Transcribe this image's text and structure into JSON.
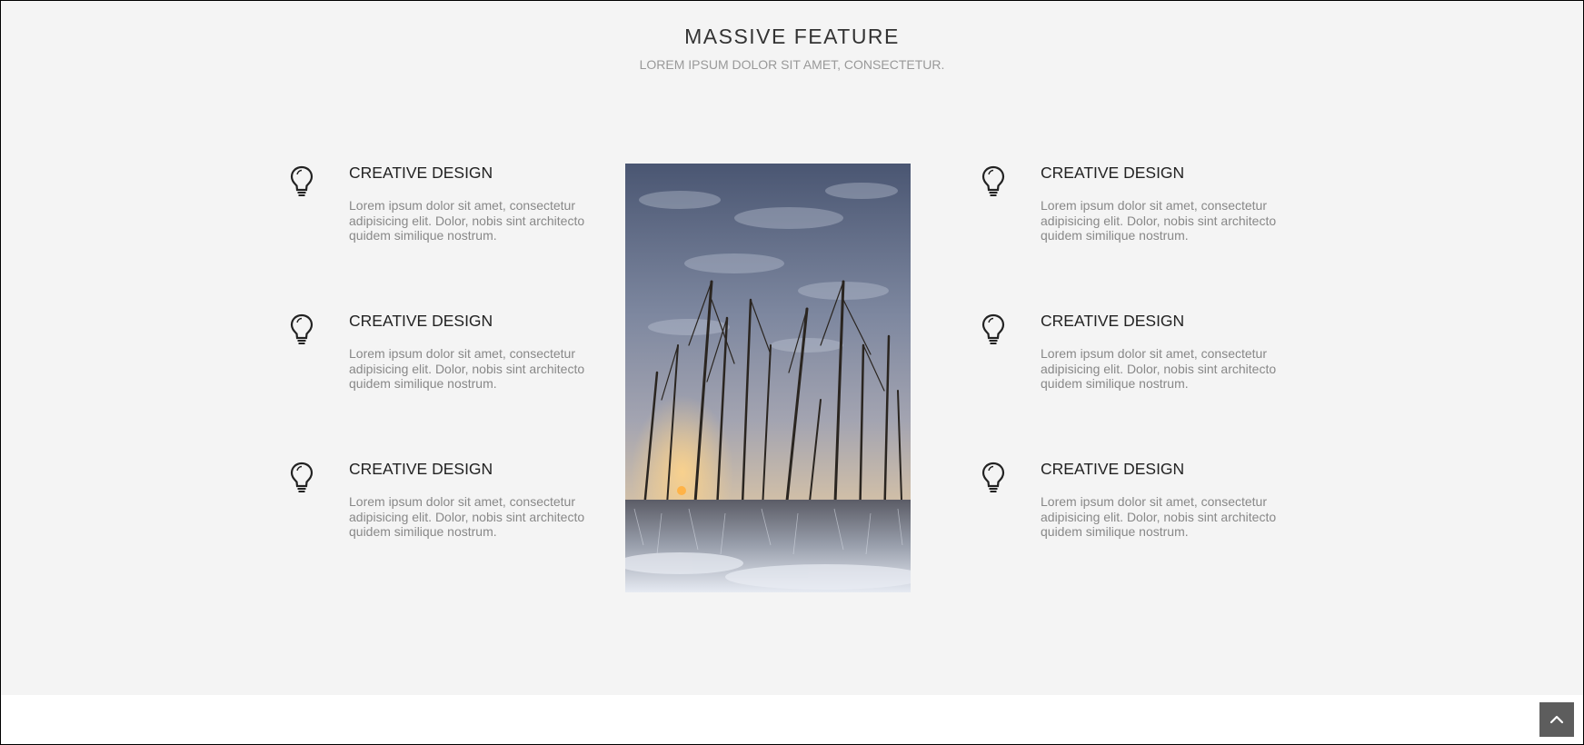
{
  "section": {
    "title": "MASSIVE FEATURE",
    "subtitle": "LOREM IPSUM DOLOR SIT AMET, CONSECTETUR."
  },
  "features": [
    {
      "icon": "lightbulb-icon",
      "title": "CREATIVE DESIGN",
      "text": "Lorem ipsum dolor sit amet, consectetur adipisicing elit. Dolor, nobis sint architecto quidem similique nostrum."
    },
    {
      "icon": "lightbulb-icon",
      "title": "CREATIVE DESIGN",
      "text": "Lorem ipsum dolor sit amet, consectetur adipisicing elit. Dolor, nobis sint architecto quidem similique nostrum."
    },
    {
      "icon": "lightbulb-icon",
      "title": "CREATIVE DESIGN",
      "text": "Lorem ipsum dolor sit amet, consectetur adipisicing elit. Dolor, nobis sint architecto quidem similique nostrum."
    },
    {
      "icon": "lightbulb-icon",
      "title": "CREATIVE DESIGN",
      "text": "Lorem ipsum dolor sit amet, consectetur adipisicing elit. Dolor, nobis sint architecto quidem similique nostrum."
    },
    {
      "icon": "lightbulb-icon",
      "title": "CREATIVE DESIGN",
      "text": "Lorem ipsum dolor sit amet, consectetur adipisicing elit. Dolor, nobis sint architecto quidem similique nostrum."
    },
    {
      "icon": "lightbulb-icon",
      "title": "CREATIVE DESIGN",
      "text": "Lorem ipsum dolor sit amet, consectetur adipisicing elit. Dolor, nobis sint architecto quidem similique nostrum."
    }
  ],
  "image": {
    "subject": "winter-trees-photo"
  },
  "scroll_top": {
    "icon": "chevron-up-icon"
  },
  "colors": {
    "section_bg": "#f4f4f4",
    "page_bg": "#ffffff",
    "scroll_button": "#5d5d5d",
    "body_text": "#888888",
    "heading_text": "#333333"
  }
}
